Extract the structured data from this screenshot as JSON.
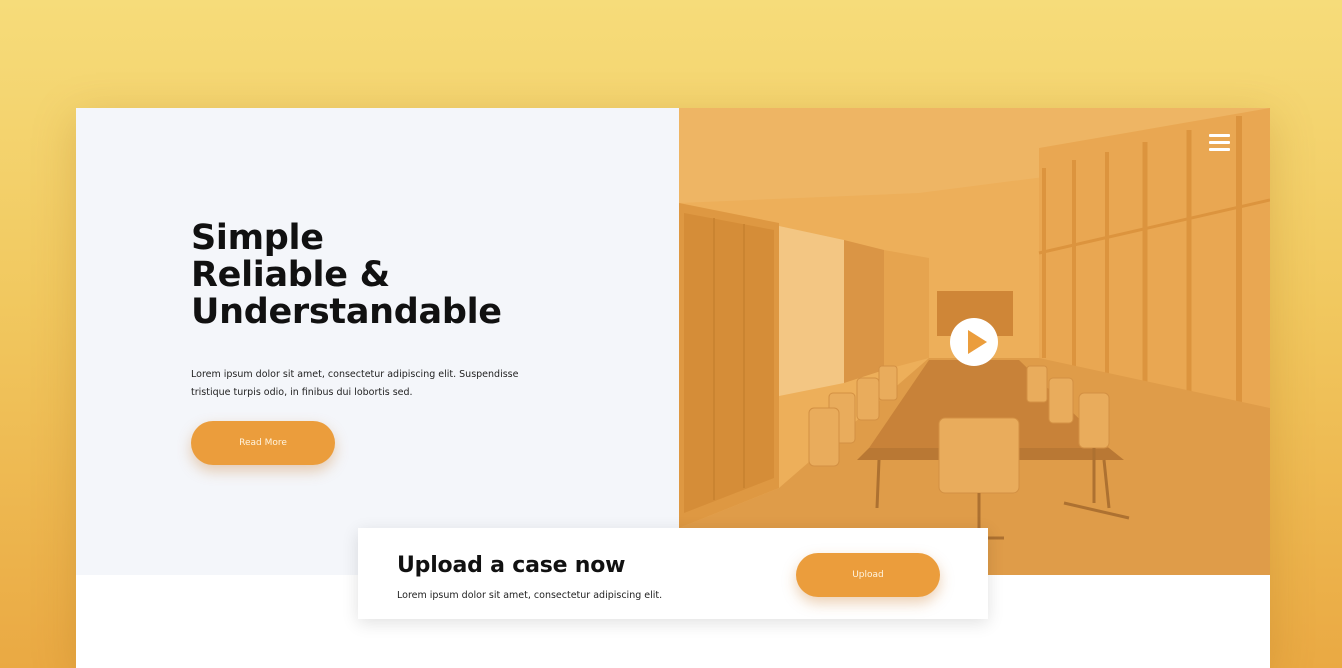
{
  "hero": {
    "title_lines": [
      "Simple",
      "Reliable &",
      "Understandable"
    ],
    "description": "Lorem ipsum dolor sit amet, consectetur adipiscing elit. Suspendisse tristique turpis odio, in finibus dui lobortis sed.",
    "read_more_label": "Read More"
  },
  "media": {
    "overlay_color": "#eb9d3c",
    "menu_icon": "hamburger-menu-icon",
    "play_icon": "play-icon"
  },
  "upload": {
    "title": "Upload a case now",
    "description": "Lorem ipsum dolor sit amet, consectetur adipiscing elit.",
    "button_label": "Upload"
  },
  "colors": {
    "accent": "#eb9d3c",
    "hero_bg": "#f4f6fa",
    "page_bg_top": "#f6dc7a",
    "page_bg_bottom": "#eaa943"
  }
}
